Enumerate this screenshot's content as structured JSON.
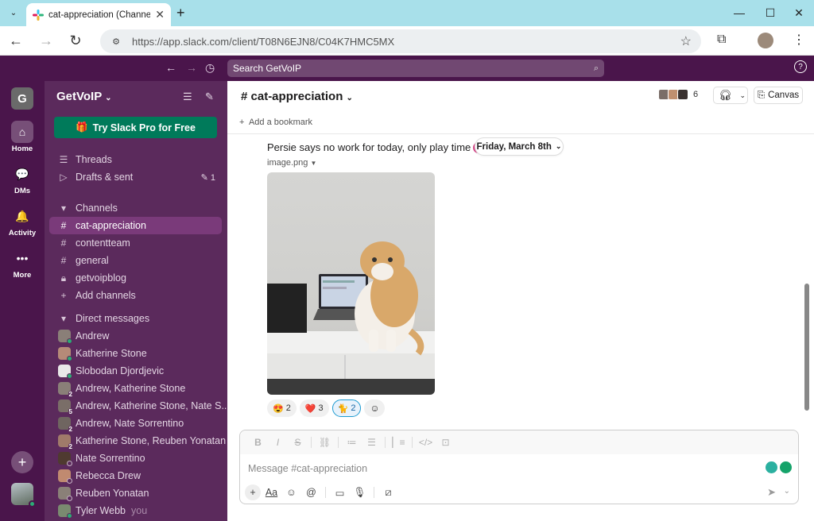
{
  "browser": {
    "tab_title": "cat-appreciation (Channel)",
    "url": "https://app.slack.com/client/T08N6EJN8/C04K7HMC5MX"
  },
  "slack": {
    "search_placeholder": "Search GetVoIP"
  },
  "rail": {
    "workspace_initial": "G",
    "items": [
      {
        "label": "Home"
      },
      {
        "label": "DMs"
      },
      {
        "label": "Activity"
      },
      {
        "label": "More"
      }
    ]
  },
  "sidebar": {
    "workspace_name": "GetVoIP",
    "try_pro": "Try Slack Pro for Free",
    "threads": "Threads",
    "drafts": "Drafts & sent",
    "drafts_count": "1",
    "channels_header": "Channels",
    "channels": [
      {
        "name": "cat-appreciation"
      },
      {
        "name": "contentteam"
      },
      {
        "name": "general"
      },
      {
        "name": "getvoipblog"
      }
    ],
    "add_channels": "Add channels",
    "dm_header": "Direct messages",
    "dms": [
      {
        "name": "Andrew",
        "color": "#8a7f78"
      },
      {
        "name": "Katherine Stone",
        "color": "#b58a78"
      },
      {
        "name": "Slobodan Djordjevic",
        "color": "#e8e8e8"
      },
      {
        "name": "Andrew, Katherine Stone",
        "count": "2",
        "color": "#8a7f78"
      },
      {
        "name": "Andrew, Katherine Stone, Nate S...",
        "count": "5",
        "color": "#7a6e68"
      },
      {
        "name": "Andrew, Nate Sorrentino",
        "count": "2",
        "color": "#6f6560"
      },
      {
        "name": "Katherine Stone, Reuben Yonatan",
        "count": "2",
        "color": "#a07a6a"
      },
      {
        "name": "Nate Sorrentino",
        "color": "#4f3a30"
      },
      {
        "name": "Rebecca Drew",
        "color": "#c08a70"
      },
      {
        "name": "Reuben Yonatan",
        "color": "#8a8078"
      },
      {
        "name": "Tyler Webb",
        "you": "you",
        "color": "#7a8a70"
      }
    ]
  },
  "channel": {
    "title": "# cat-appreciation",
    "member_count": "6",
    "canvas": "Canvas",
    "bookmark": "Add a bookmark"
  },
  "message": {
    "text": "Persie says no work for today, only play time",
    "date": "Friday, March 8th",
    "file_name": "image.png",
    "reactions": [
      {
        "emoji": "😍",
        "count": "2"
      },
      {
        "emoji": "❤️",
        "count": "3"
      },
      {
        "emoji": "🐈",
        "count": "2"
      }
    ]
  },
  "composer": {
    "placeholder": "Message #cat-appreciation"
  }
}
